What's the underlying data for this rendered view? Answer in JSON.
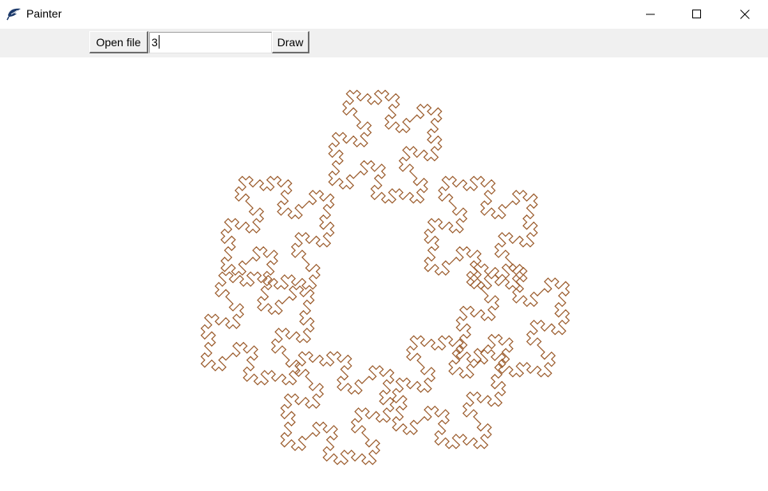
{
  "window": {
    "title": "Painter",
    "app_icon": "feather-app-icon",
    "controls": {
      "minimize_icon": "minimize-icon",
      "maximize_icon": "maximize-icon",
      "close_icon": "close-icon"
    }
  },
  "toolbar": {
    "open_file_label": "Open file",
    "depth_value": "3",
    "draw_label": "Draw"
  },
  "canvas": {
    "stroke_color": "#9a5a2a",
    "background": "#ffffff",
    "fractal": {
      "motif": "square-curve fractal arranged as four petals",
      "depth_value": "3"
    }
  }
}
